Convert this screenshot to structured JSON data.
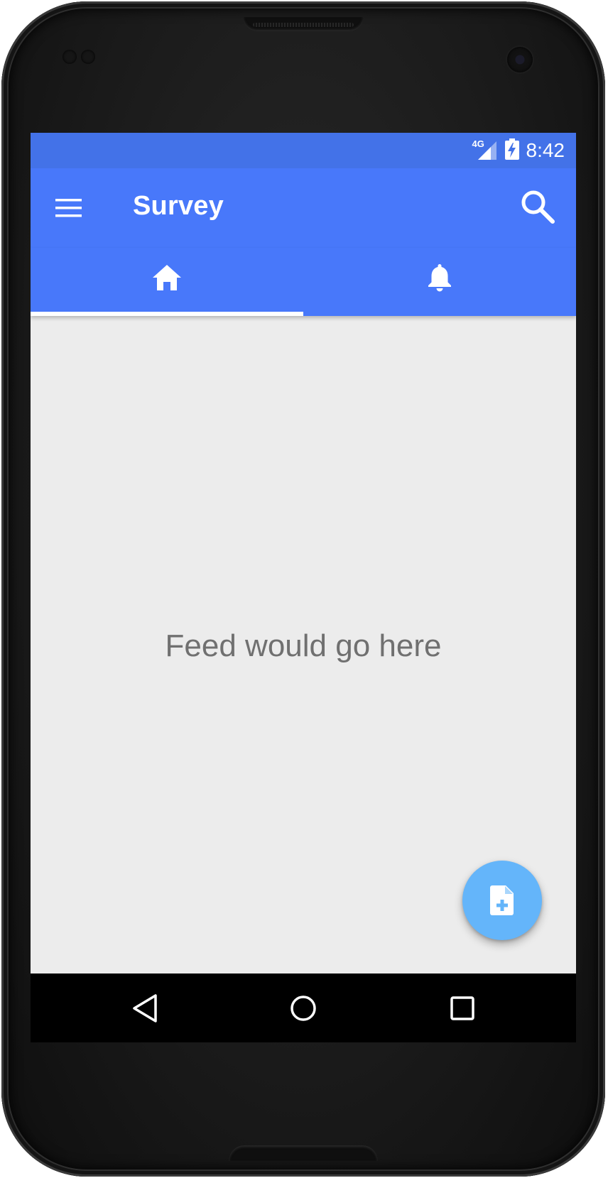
{
  "status_bar": {
    "network": "4G",
    "time": "8:42"
  },
  "app_bar": {
    "title": "Survey",
    "menu_icon": "menu-icon",
    "search_icon": "search-icon",
    "background": "#4878fa"
  },
  "tabs": [
    {
      "icon": "home-icon",
      "selected": true
    },
    {
      "icon": "bell-icon",
      "selected": false
    }
  ],
  "content": {
    "empty_message": "Feed would go here",
    "background": "#ececec"
  },
  "fab": {
    "icon": "note-add-icon",
    "color": "#64b5fa"
  },
  "nav_bar": {
    "buttons": [
      "back-icon",
      "home-circle-icon",
      "recents-icon"
    ]
  }
}
